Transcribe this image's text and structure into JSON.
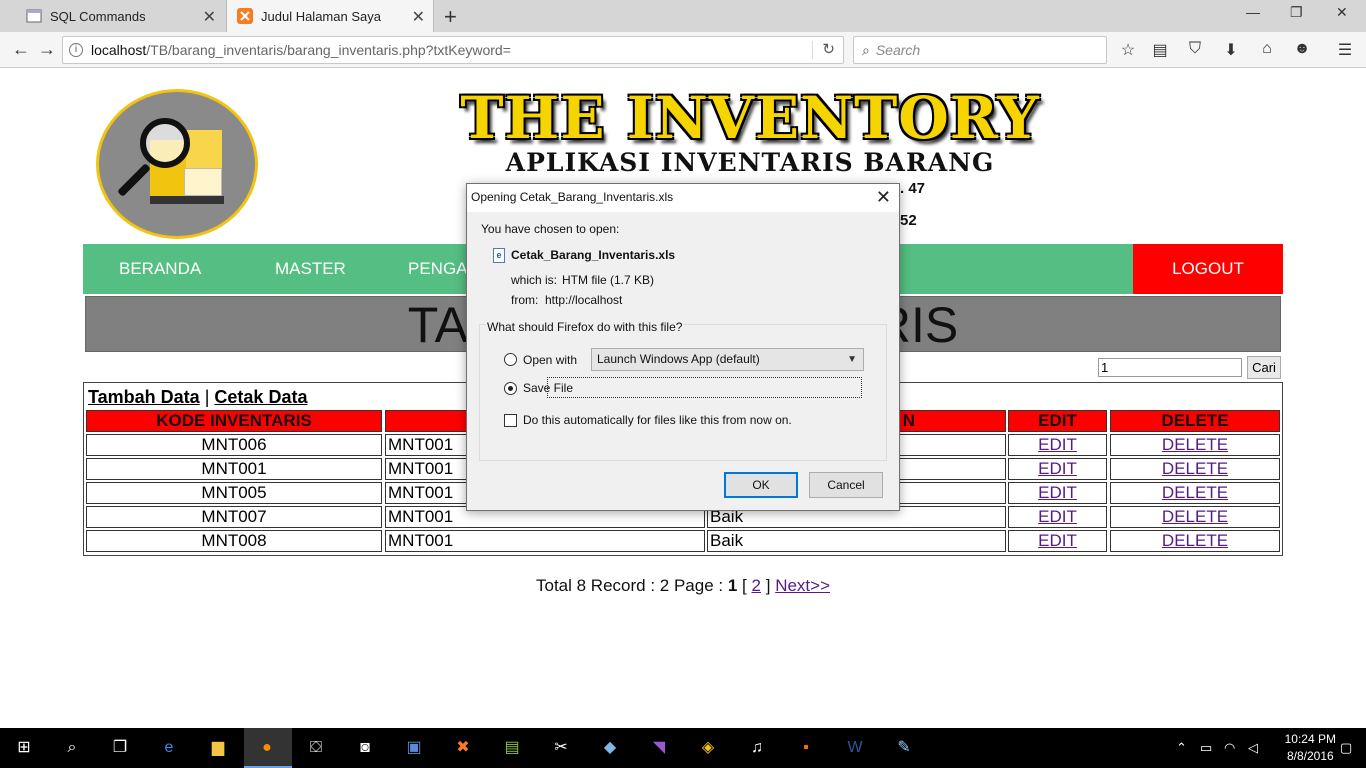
{
  "browser": {
    "tabs": [
      {
        "title": "SQL Commands",
        "active": false
      },
      {
        "title": "Judul Halaman Saya",
        "active": true
      }
    ],
    "url_host": "localhost",
    "url_path": "/TB/barang_inventaris/barang_inventaris.php?txtKeyword=",
    "search_placeholder": "Search"
  },
  "header": {
    "title": "THE INVENTORY",
    "subtitle": "APLIKASI INVENTARIS BARANG",
    "addr_line1": ". 47",
    "addr_line2": "52"
  },
  "menu": {
    "items": [
      "BERANDA",
      "MASTER",
      "PENGA"
    ],
    "logout": "LOGOUT"
  },
  "page": {
    "table_title_left": "TABE",
    "table_title_right": "TARIS",
    "search_value": "1",
    "search_button": "Cari",
    "add_link": "Tambah Data",
    "separator": "|",
    "print_link": "Cetak Data",
    "columns": [
      "KODE INVENTARIS",
      "",
      "N",
      "EDIT",
      "DELETE"
    ],
    "rows": [
      {
        "kode": "MNT006",
        "col2": "MNT001",
        "col3": "",
        "edit": "EDIT",
        "delete": "DELETE"
      },
      {
        "kode": "MNT001",
        "col2": "MNT001",
        "col3": "",
        "edit": "EDIT",
        "delete": "DELETE"
      },
      {
        "kode": "MNT005",
        "col2": "MNT001",
        "col3": "",
        "edit": "EDIT",
        "delete": "DELETE"
      },
      {
        "kode": "MNT007",
        "col2": "MNT001",
        "col3": "Baik",
        "edit": "EDIT",
        "delete": "DELETE"
      },
      {
        "kode": "MNT008",
        "col2": "MNT001",
        "col3": "Baik",
        "edit": "EDIT",
        "delete": "DELETE"
      }
    ],
    "pager": {
      "prefix": "Total 8 Record : 2 Page :",
      "current": "1",
      "open": "[",
      "page2": "2",
      "close": "]",
      "next": "Next>>"
    }
  },
  "dialog": {
    "title": "Opening Cetak_Barang_Inventaris.xls",
    "chosen": "You have chosen to open:",
    "filename": "Cetak_Barang_Inventaris.xls",
    "which_is_label": "which is:",
    "which_is_value": "HTM file (1.7 KB)",
    "from_label": "from:",
    "from_value": "http://localhost",
    "question": "What should Firefox do with this file?",
    "open_with_label": "Open with",
    "open_with_value": "Launch Windows App (default)",
    "save_file_label": "Save File",
    "auto_label": "Do this automatically for files like this from now on.",
    "ok": "OK",
    "cancel": "Cancel"
  },
  "taskbar": {
    "time": "10:24 PM",
    "date": "8/8/2016"
  },
  "colors": {
    "menu_green": "#55be82",
    "logout_red": "#ff0000",
    "header_red": "#ff0000",
    "title_gray": "#808080",
    "brand_yellow": "#f6d400"
  }
}
